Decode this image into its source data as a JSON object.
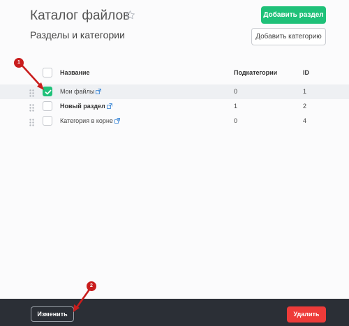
{
  "header": {
    "title": "Каталог файлов",
    "subtitle": "Разделы и категории",
    "add_section_label": "Добавить раздел",
    "add_category_label": "Добавить категорию"
  },
  "table": {
    "columns": {
      "name": "Название",
      "subcategories": "Подкатегории",
      "id": "ID"
    },
    "rows": [
      {
        "name": "Мои файлы",
        "subcategories": "0",
        "id": "1",
        "checked": true,
        "bold": false
      },
      {
        "name": "Новый раздел",
        "subcategories": "1",
        "id": "2",
        "checked": false,
        "bold": true
      },
      {
        "name": "Категория в корне",
        "subcategories": "0",
        "id": "4",
        "checked": false,
        "bold": false
      }
    ]
  },
  "footer": {
    "edit_label": "Изменить",
    "delete_label": "Удалить"
  },
  "annotations": {
    "marker1": "1",
    "marker2": "2"
  },
  "colors": {
    "accent": "#1fc179",
    "danger": "#ee3b39",
    "footer_bg": "#2b2f36",
    "annotation": "#c91d1d",
    "link": "#4a90d9"
  }
}
